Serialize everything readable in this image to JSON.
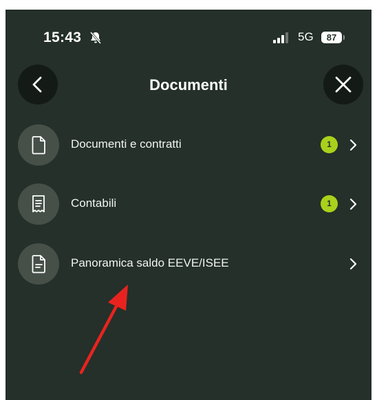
{
  "status_bar": {
    "time": "15:43",
    "network": "5G",
    "battery": "87",
    "icons": [
      "bell-slash-icon",
      "signal-icon",
      "battery-icon"
    ]
  },
  "header": {
    "title": "Documenti",
    "back_icon": "chevron-left-icon",
    "close_icon": "close-icon"
  },
  "menu": {
    "items": [
      {
        "label": "Documenti e contratti",
        "icon": "document-icon",
        "badge": "1"
      },
      {
        "label": "Contabili",
        "icon": "receipt-icon",
        "badge": "1"
      },
      {
        "label": "Panoramica saldo EEVE/ISEE",
        "icon": "document-lines-icon",
        "badge": ""
      }
    ]
  },
  "annotation": {
    "arrow_color": "#e8231f"
  },
  "colors": {
    "background": "#243029",
    "icon_circle": "#465049",
    "button_circle": "#141b17",
    "badge": "#a9d11c"
  }
}
